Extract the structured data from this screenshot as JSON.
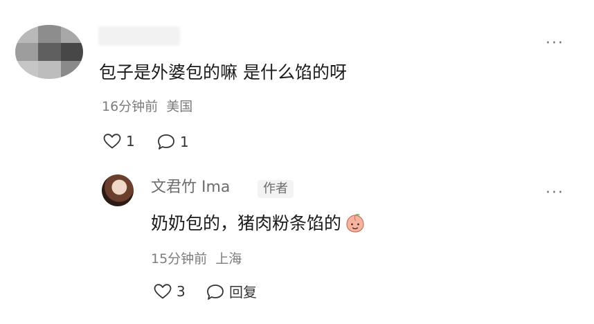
{
  "comment": {
    "text": "包子是外婆包的嘛 是什么馅的呀",
    "time": "16分钟前",
    "location": "美国",
    "like_count": "1",
    "reply_count": "1",
    "more": "···"
  },
  "reply": {
    "username": "文君竹 Ima",
    "author_badge": "作者",
    "text": "奶奶包的，猪肉粉条馅的",
    "emoji": "peach-face-emoji",
    "time": "15分钟前",
    "location": "上海",
    "like_count": "3",
    "reply_label": "回复",
    "more": "···"
  },
  "icons": {
    "like": "heart-outline-icon",
    "reply": "speech-bubble-icon",
    "more": "more-dots-icon"
  },
  "colors": {
    "text": "#1a1a1a",
    "meta": "#7b7b7b",
    "badge_bg": "#f3f3f3",
    "emoji": "#f4a38b"
  }
}
